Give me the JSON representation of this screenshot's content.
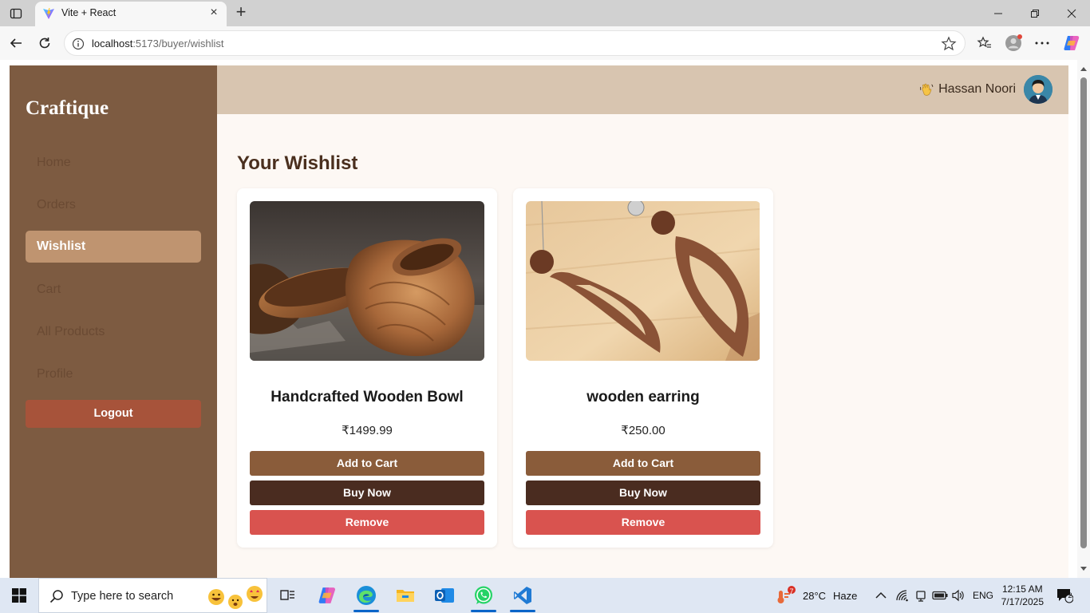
{
  "browser": {
    "tab_title": "Vite + React",
    "url_host": "localhost",
    "url_rest": ":5173/buyer/wishlist"
  },
  "sidebar": {
    "brand": "Craftique",
    "items": [
      {
        "label": "Home",
        "active": false
      },
      {
        "label": "Orders",
        "active": false
      },
      {
        "label": "Wishlist",
        "active": true
      },
      {
        "label": "Cart",
        "active": false
      },
      {
        "label": "All Products",
        "active": false
      },
      {
        "label": "Profile",
        "active": false
      }
    ],
    "logout_label": "Logout"
  },
  "header": {
    "greeting_icon": "waving-hand-icon",
    "user_name": "Hassan Noori"
  },
  "main": {
    "title": "Your Wishlist",
    "products": [
      {
        "name": "Handcrafted Wooden Bowl",
        "price": "₹1499.99",
        "image": "wooden-bowl-image"
      },
      {
        "name": "wooden earring",
        "price": "₹250.00",
        "image": "wooden-earring-image"
      }
    ],
    "buttons": {
      "add_to_cart": "Add to Cart",
      "buy_now": "Buy Now",
      "remove": "Remove"
    }
  },
  "taskbar": {
    "search_placeholder": "Type here to search",
    "weather_temp": "28°C",
    "weather_desc": "Haze",
    "weather_badge": "7",
    "language": "ENG",
    "time": "12:15 AM",
    "date": "7/17/2025",
    "notification_count": "2"
  },
  "colors": {
    "sidebar_bg": "#7d5b41",
    "active_nav": "#bf9470",
    "logout": "#a7533a",
    "header_bg": "#d8c5b0",
    "add_to_cart": "#8a5c3a",
    "buy_now": "#4a2c20",
    "remove": "#d9534f"
  }
}
